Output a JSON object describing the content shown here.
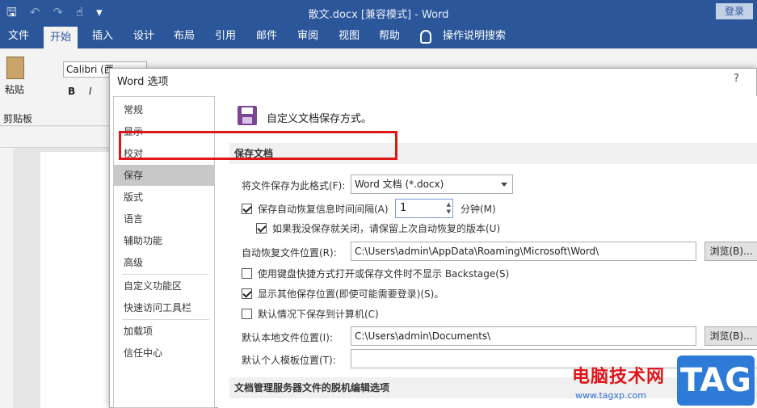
{
  "titlebar": {
    "title": "散文.docx [兼容模式]  -  Word",
    "login": "登录",
    "qat": {
      "save": "🖫",
      "undo": "↶",
      "undo_menu": "⌄",
      "redo": "↷",
      "touch": "☝",
      "more": "▾"
    }
  },
  "tabs": [
    "文件",
    "开始",
    "插入",
    "设计",
    "布局",
    "引用",
    "邮件",
    "审阅",
    "视图",
    "帮助",
    "操作说明搜索"
  ],
  "ribbon": {
    "paste": "粘贴",
    "clipboard": "剪贴板",
    "font": "Calibri (西",
    "bold": "B",
    "italic": "I"
  },
  "dialog": {
    "title": "Word 选项",
    "help": "?",
    "nav": [
      "常规",
      "显示",
      "校对",
      "保存",
      "版式",
      "语言",
      "辅助功能",
      "高级",
      "自定义功能区",
      "快速访问工具栏",
      "加载项",
      "信任中心"
    ],
    "selected_nav": "保存",
    "headline": "自定义文档保存方式。",
    "section_save": "保存文档",
    "format_label": "将文件保存为此格式(F):",
    "format_value": "Word 文档 (*.docx)",
    "autorecover_label": "保存自动恢复信息时间间隔(A)",
    "autorecover_value": "1",
    "minutes_label": "分钟(M)",
    "keep_last_label": "如果我没保存就关闭，请保留上次自动恢复的版本(U)",
    "autorecover_path_label": "自动恢复文件位置(R):",
    "autorecover_path": "C:\\Users\\admin\\AppData\\Roaming\\Microsoft\\Word\\",
    "browse1": "浏览(B)...",
    "backstage_label": "使用键盘快捷方式打开或保存文件时不显示 Backstage(S)",
    "show_other_label": "显示其他保存位置(即使可能需要登录)(S)。",
    "save_pc_label": "默认情况下保存到计算机(C)",
    "local_path_label": "默认本地文件位置(I):",
    "local_path": "C:\\Users\\admin\\Documents\\",
    "browse2": "浏览(B)...",
    "template_label": "默认个人模板位置(T):",
    "template_path": "",
    "section_offline": "文档管理服务器文件的脱机编辑选项"
  },
  "watermark": {
    "site": "电脑技术网",
    "url": "www.tagxp.com",
    "badge": "TAG"
  }
}
